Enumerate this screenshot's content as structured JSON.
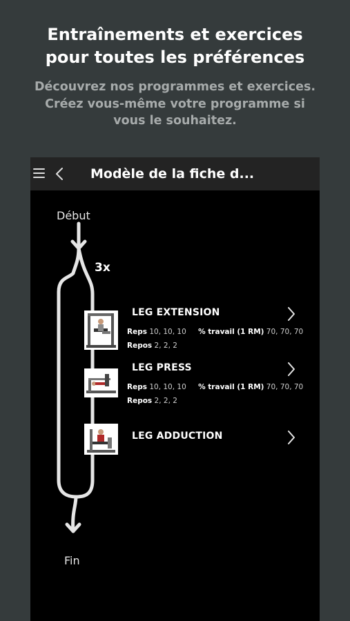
{
  "promo": {
    "title_line1": "Entraînements et exercices",
    "title_line2": "pour toutes les préférences",
    "subtitle_line1": "Découvrez nos programmes et exercices.",
    "subtitle_line2": "Créez vous-même votre programme si",
    "subtitle_line3": "vous le souhaitez."
  },
  "appbar": {
    "menu_icon": "hamburger-menu-icon",
    "back_icon": "chevron-left-icon",
    "title": "Modèle de la fiche d..."
  },
  "flow": {
    "start_label": "Début",
    "end_label": "Fin",
    "repeat_label": "3x"
  },
  "exercises": [
    {
      "name": "LEG EXTENSION",
      "reps_label": "Reps",
      "reps_value": "10, 10, 10",
      "work_label": "% travail (1 RM)",
      "work_value": "70, 70, 70",
      "rest_label": "Repos",
      "rest_value": "2, 2, 2"
    },
    {
      "name": "LEG PRESS",
      "reps_label": "Reps",
      "reps_value": "10, 10, 10",
      "work_label": "% travail (1 RM)",
      "work_value": "70, 70, 70",
      "rest_label": "Repos",
      "rest_value": "2, 2, 2"
    },
    {
      "name": "LEG ADDUCTION"
    }
  ],
  "colors": {
    "background": "#353b3c",
    "phone_bg": "#000000",
    "appbar_bg": "#232323",
    "subtitle": "#a7abab"
  }
}
